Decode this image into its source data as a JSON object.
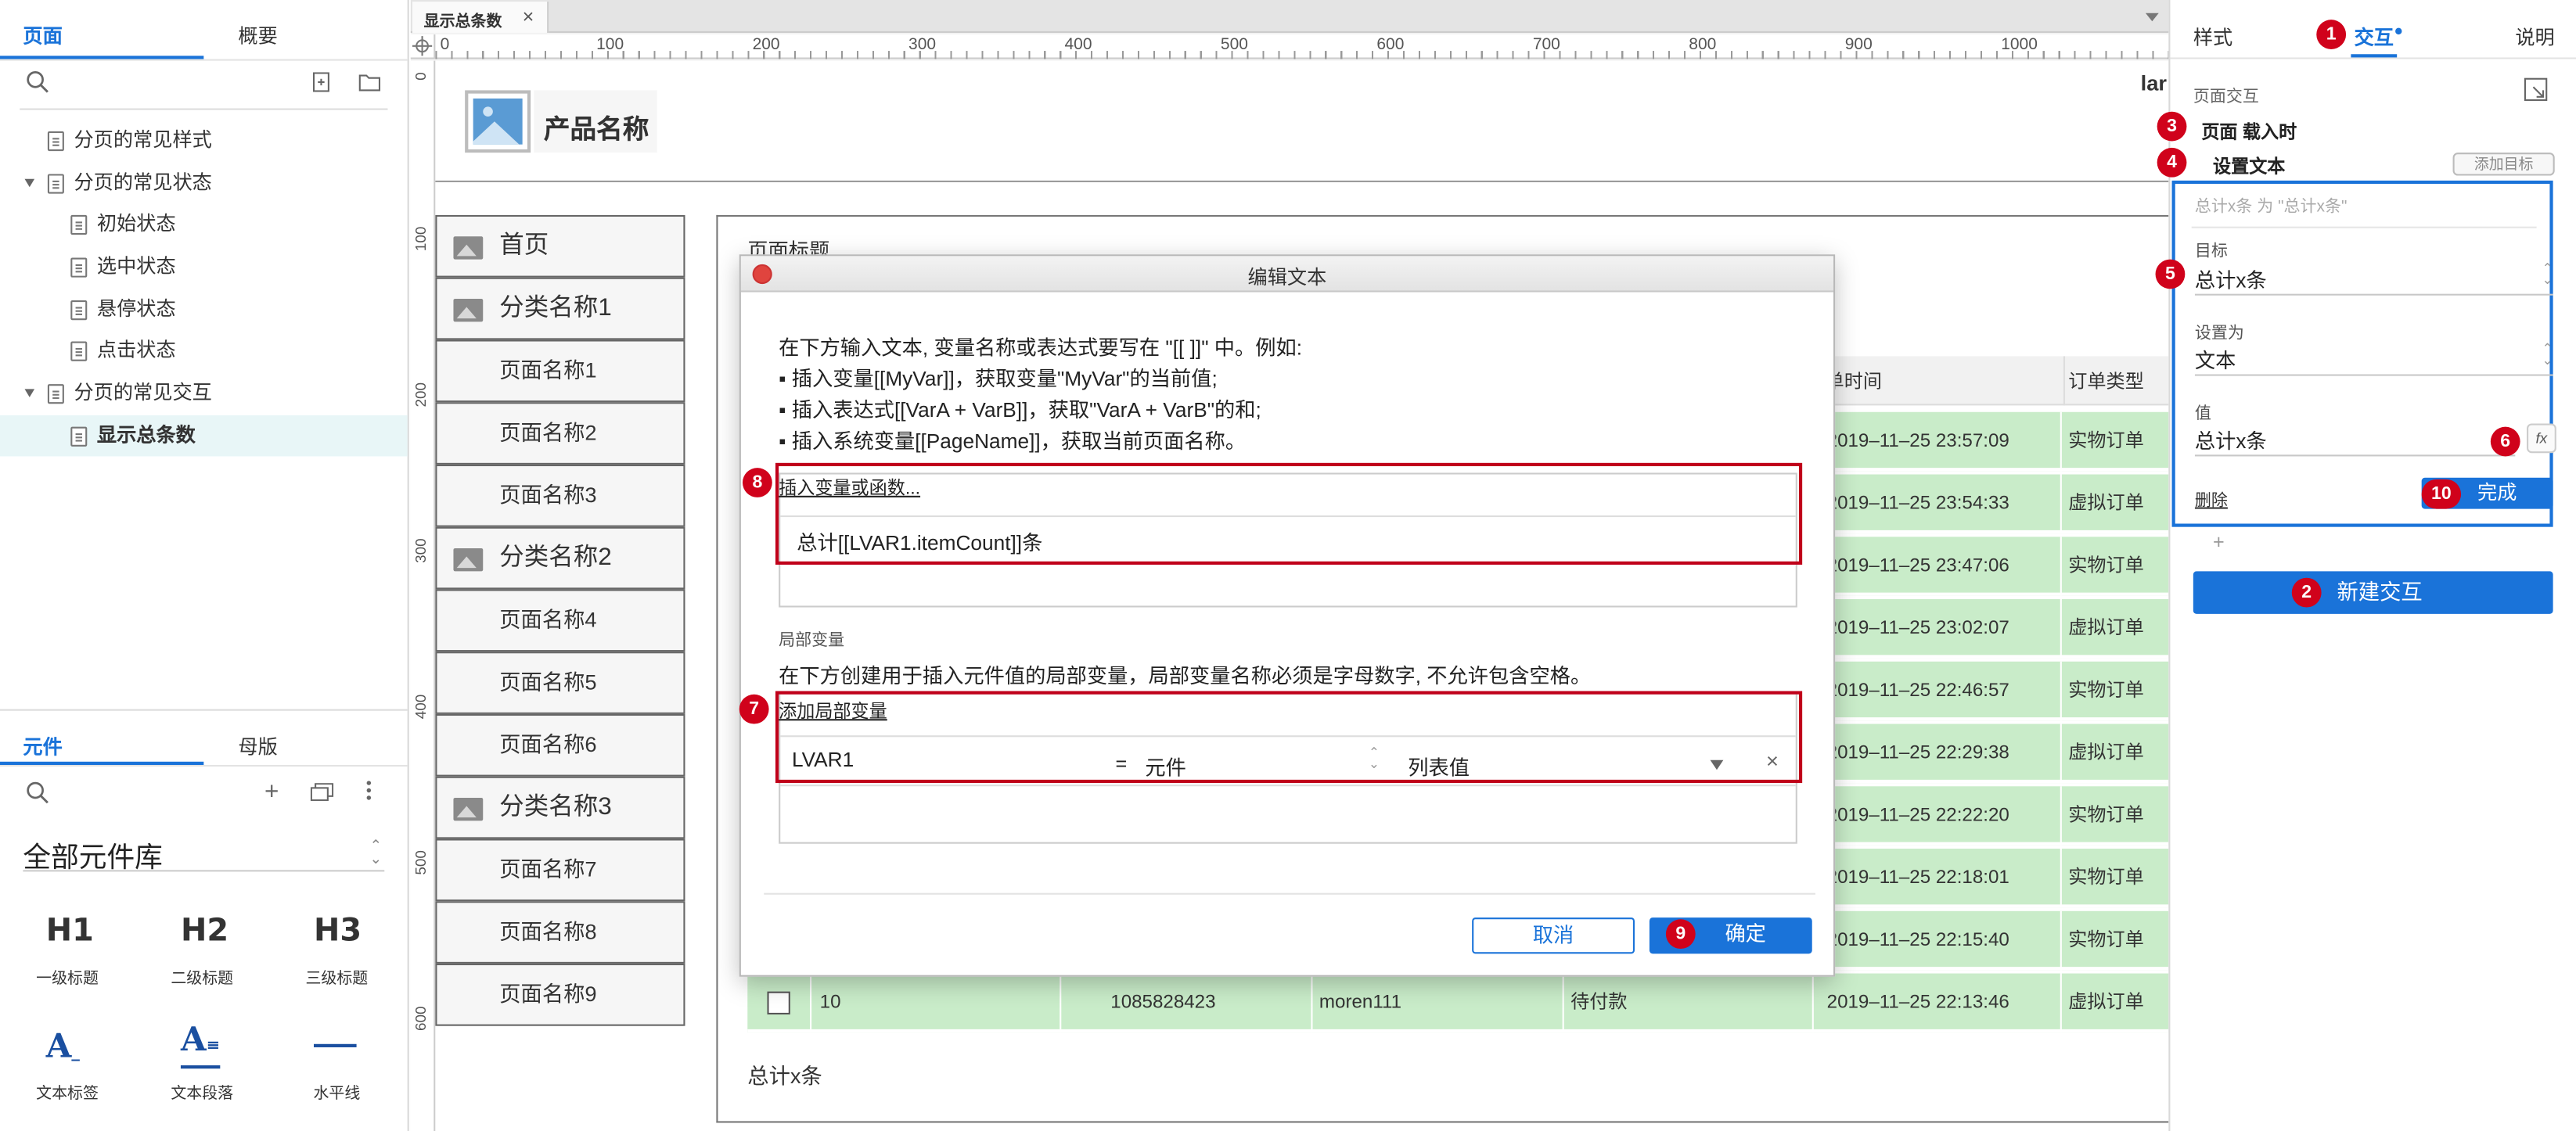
{
  "left_panel": {
    "tabs": {
      "pages": "页面",
      "outline": "概要"
    },
    "pages": [
      {
        "label": "分页的常见样式"
      },
      {
        "label": "分页的常见状态"
      },
      {
        "label": "初始状态"
      },
      {
        "label": "选中状态"
      },
      {
        "label": "悬停状态"
      },
      {
        "label": "点击状态"
      },
      {
        "label": "分页的常见交互"
      },
      {
        "label": "显示总条数"
      }
    ],
    "lib_tabs": {
      "widgets": "元件",
      "masters": "母版"
    },
    "library_select": "全部元件库",
    "widgets": [
      {
        "glyph": "H1",
        "label": "一级标题"
      },
      {
        "glyph": "H2",
        "label": "二级标题"
      },
      {
        "glyph": "H3",
        "label": "三级标题"
      },
      {
        "glyph": "A",
        "label": "文本标签"
      },
      {
        "glyph": "A",
        "label": "文本段落"
      },
      {
        "glyph": "",
        "label": "水平线"
      }
    ]
  },
  "doc_tab": {
    "label": "显示总条数",
    "close": "×"
  },
  "ruler": {
    "top": [
      "0",
      "100",
      "200",
      "300",
      "400",
      "500",
      "600",
      "700",
      "800",
      "900",
      "1000"
    ],
    "left": [
      "0",
      "100",
      "200",
      "300",
      "400",
      "500",
      "600"
    ]
  },
  "canvas": {
    "product_name": "产品名称",
    "top_right_text": "lar",
    "page_title": "页面标题",
    "nav": [
      {
        "label": "首页",
        "cat": true
      },
      {
        "label": "分类名称1",
        "cat": true
      },
      {
        "label": "页面名称1",
        "cat": false
      },
      {
        "label": "页面名称2",
        "cat": false
      },
      {
        "label": "页面名称3",
        "cat": false
      },
      {
        "label": "分类名称2",
        "cat": true
      },
      {
        "label": "页面名称4",
        "cat": false
      },
      {
        "label": "页面名称5",
        "cat": false
      },
      {
        "label": "页面名称6",
        "cat": false
      },
      {
        "label": "分类名称3",
        "cat": true
      },
      {
        "label": "页面名称7",
        "cat": false
      },
      {
        "label": "页面名称8",
        "cat": false
      },
      {
        "label": "页面名称9",
        "cat": false
      }
    ],
    "table_headers": {
      "time": "单时间",
      "type": "订单类型"
    },
    "rows": [
      {
        "time": "2019–11–25 23:57:09",
        "type": "实物订单"
      },
      {
        "time": "2019–11–25 23:54:33",
        "type": "虚拟订单"
      },
      {
        "time": "2019–11–25 23:47:06",
        "type": "实物订单"
      },
      {
        "time": "2019–11–25 23:02:07",
        "type": "虚拟订单"
      },
      {
        "time": "2019–11–25 22:46:57",
        "type": "实物订单"
      },
      {
        "time": "2019–11–25 22:29:38",
        "type": "虚拟订单"
      },
      {
        "time": "2019–11–25 22:22:20",
        "type": "实物订单"
      },
      {
        "time": "2019–11–25 22:18:01",
        "type": "实物订单"
      },
      {
        "time": "2019–11–25 22:15:40",
        "type": "实物订单"
      }
    ],
    "last_row": {
      "index": "10",
      "order_no": "1085828423",
      "user": "moren111",
      "status": "待付款",
      "time": "2019–11–25 22:13:46",
      "type": "虚拟订单"
    },
    "total_text": "总计x条"
  },
  "dialog": {
    "title": "编辑文本",
    "intro": [
      "在下方输入文本, 变量名称或表达式要写在 \"[[ ]]\" 中。例如:",
      "▪ 插入变量[[MyVar]]，获取变量\"MyVar\"的当前值;",
      "▪ 插入表达式[[VarA + VarB]]，获取\"VarA + VarB\"的和;",
      "▪ 插入系统变量[[PageName]]，获取当前页面名称。"
    ],
    "insert_link": "插入变量或函数...",
    "expression": "总计[[LVAR1.itemCount]]条",
    "local_var_header": "局部变量",
    "local_var_desc": "在下方创建用于插入元件值的局部变量，局部变量名称必须是字母数字, 不允许包含空格。",
    "add_local_var": "添加局部变量",
    "var_name": "LVAR1",
    "equals": "=",
    "var_source": "元件",
    "var_value": "列表值",
    "remove": "×",
    "cancel": "取消",
    "ok": "确定"
  },
  "right_panel": {
    "tabs": {
      "style": "样式",
      "interact": "交互",
      "notes": "说明"
    },
    "page_interactions": "页面交互",
    "event": "页面 载入时",
    "action": "设置文本",
    "add_target": "添加目标",
    "summary": "总计x条 为 \"总计x条\"",
    "target_label": "目标",
    "target_value": "总计x条",
    "set_as_label": "设置为",
    "set_as_value": "文本",
    "value_label": "值",
    "value_value": "总计x条",
    "fx": "fx",
    "delete": "删除",
    "done": "完成",
    "plus": "+",
    "new_interaction": "新建交互"
  },
  "annotations": [
    "1",
    "2",
    "3",
    "4",
    "5",
    "6",
    "7",
    "8",
    "9",
    "10"
  ],
  "colors": {
    "accent": "#1a73d9",
    "marker": "#d0021b",
    "row_green": "#c9ecc9",
    "selected_row": "#e8f6f7"
  }
}
